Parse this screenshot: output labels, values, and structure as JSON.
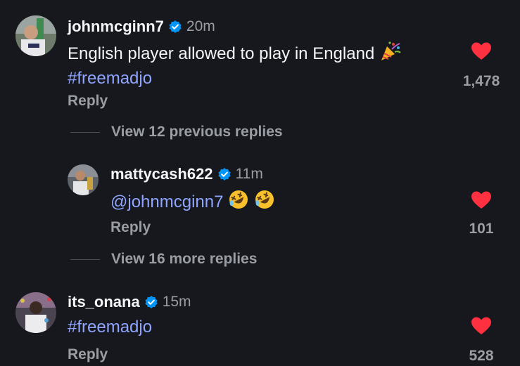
{
  "comments": [
    {
      "username": "johnmcginn7",
      "time": "20m",
      "text": "English player allowed to play in England",
      "hashtag": "#freemadjo",
      "reply_label": "Reply",
      "likes": "1,478"
    },
    {
      "username": "mattycash622",
      "time": "11m",
      "mention": "@johnmcginn7",
      "reply_label": "Reply",
      "likes": "101"
    },
    {
      "username": "its_onana",
      "time": "15m",
      "hashtag": "#freemadjo",
      "reply_label": "Reply",
      "likes": "528"
    }
  ],
  "view_previous_replies": "View 12 previous replies",
  "view_more_replies": "View 16 more replies",
  "icons": {
    "verified": "verified-badge-icon",
    "like": "heart-icon",
    "party": "party-popper-emoji",
    "laugh": "rolling-laughing-emoji"
  },
  "colors": {
    "background": "#16181d",
    "text": "#f3f5f7",
    "muted": "#9a9da3",
    "link": "#8fa5ff",
    "heart": "#ff3040",
    "verified": "#0095f6"
  }
}
